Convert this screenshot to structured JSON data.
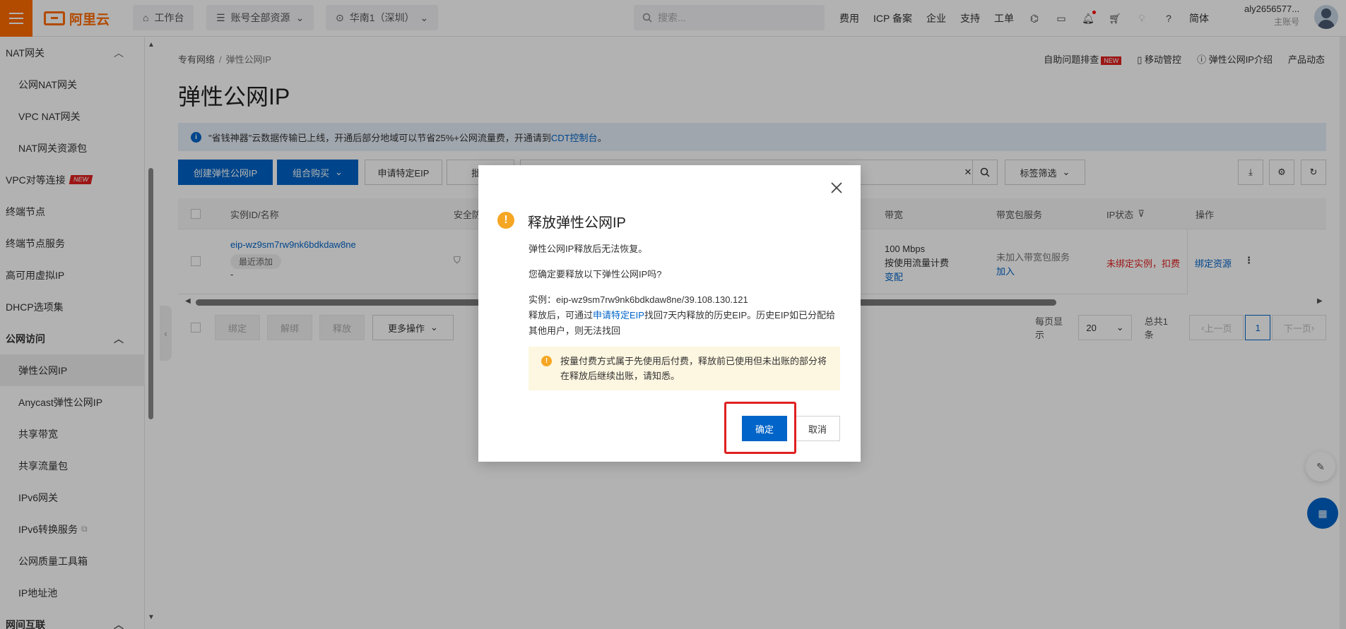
{
  "topbar": {
    "logo_text": "阿里云",
    "workbench": "工作台",
    "account_resources": "账号全部资源",
    "region": "华南1（深圳）",
    "search_placeholder": "搜索...",
    "links": [
      "费用",
      "ICP 备案",
      "企业",
      "支持",
      "工单"
    ],
    "lang": "简体",
    "user_name": "aly2656577...",
    "user_role": "主账号"
  },
  "sidebar": {
    "items": [
      {
        "label": "NAT网关",
        "kind": "group-top"
      },
      {
        "label": "公网NAT网关",
        "kind": "sub"
      },
      {
        "label": "VPC NAT网关",
        "kind": "sub"
      },
      {
        "label": "NAT网关资源包",
        "kind": "sub"
      },
      {
        "label": "VPC对等连接",
        "kind": "top",
        "badge": "NEW"
      },
      {
        "label": "终端节点",
        "kind": "top"
      },
      {
        "label": "终端节点服务",
        "kind": "top"
      },
      {
        "label": "高可用虚拟IP",
        "kind": "top"
      },
      {
        "label": "DHCP选项集",
        "kind": "top"
      },
      {
        "label": "公网访问",
        "kind": "group"
      },
      {
        "label": "弹性公网IP",
        "kind": "sub",
        "active": true
      },
      {
        "label": "Anycast弹性公网IP",
        "kind": "sub"
      },
      {
        "label": "共享带宽",
        "kind": "sub"
      },
      {
        "label": "共享流量包",
        "kind": "sub"
      },
      {
        "label": "IPv6网关",
        "kind": "sub"
      },
      {
        "label": "IPv6转换服务",
        "kind": "sub",
        "external": true
      },
      {
        "label": "公网质量工具箱",
        "kind": "sub"
      },
      {
        "label": "IP地址池",
        "kind": "sub"
      },
      {
        "label": "网间互联",
        "kind": "group"
      }
    ]
  },
  "breadcrumb": {
    "parent": "专有网络",
    "current": "弹性公网IP"
  },
  "top_actions": {
    "self_check": "自助问题排查",
    "new_badge": "NEW",
    "mobile": "移动管控",
    "intro": "弹性公网IP介绍",
    "news": "产品动态"
  },
  "page_title": "弹性公网IP",
  "notice": {
    "text": "\"省钱神器\"云数据传输已上线，开通后部分地域可以节省25%+公网流量费，开通请到",
    "link": "CDT控制台",
    "tail": "。"
  },
  "toolbar": {
    "create": "创建弹性公网IP",
    "combo": "组合购买",
    "apply": "申请特定EIP",
    "batch": "批量",
    "tag_filter": "标签筛选"
  },
  "table": {
    "headers": {
      "instance": "实例ID/名称",
      "security": "安全防",
      "bandwidth": "带宽",
      "package": "带宽包服务",
      "ip_status": "IP状态",
      "ops": "操作"
    },
    "row": {
      "instance_id": "eip-wz9sm7rw9nk6bdkdaw8ne",
      "recent_tag": "最近添加",
      "name": "-",
      "bandwidth": "100 Mbps",
      "billing": "按使用流量计费",
      "change": "变配",
      "package": "未加入带宽包服务",
      "join": "加入",
      "status": "未绑定实例，扣费",
      "bind": "绑定资源"
    }
  },
  "bottom": {
    "bind": "绑定",
    "unbind": "解绑",
    "release": "释放",
    "more": "更多操作",
    "per_page_label": "每页显示",
    "per_page": "20",
    "total": "总共1条",
    "prev": "上一页",
    "page": "1",
    "next": "下一页"
  },
  "modal": {
    "title": "释放弹性公网IP",
    "line1": "弹性公网IP释放后无法恢复。",
    "line2": "您确定要释放以下弹性公网IP吗?",
    "instance_line": "实例：eip-wz9sm7rw9nk6bdkdaw8ne/39.108.130.121",
    "after_prefix": "释放后，可通过",
    "after_link": "申请特定EIP",
    "after_suffix": "找回7天内释放的历史EIP。历史EIP如已分配给其他用户，则无法找回",
    "warning": "按量付费方式属于先使用后付费，释放前已使用但未出账的部分将在释放后继续出账，请知悉。",
    "ok": "确定",
    "cancel": "取消"
  },
  "colors": {
    "brand": "#ff6a00",
    "primary": "#0064c8",
    "danger": "#e02020",
    "warn": "#f5a623"
  }
}
